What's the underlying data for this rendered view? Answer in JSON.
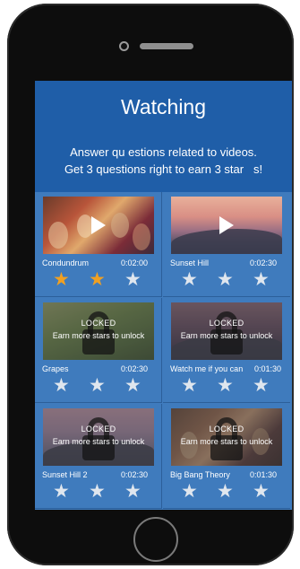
{
  "header": {
    "title": "Watching",
    "subtitle_line1": "Answer qu estions related to videos.",
    "subtitle_line2": "Get 3 questions right to earn 3 star   s!"
  },
  "lock_labels": {
    "title": "LOCKED",
    "subtitle": "Earn more stars to unlock"
  },
  "videos": [
    {
      "name": "Condundrum",
      "duration": "0:02:00",
      "locked": false,
      "stars_earned": 2,
      "stars_total": 3,
      "thumbnail": "sitcom-scene"
    },
    {
      "name": "Sunset Hill",
      "duration": "0:02:30",
      "locked": false,
      "stars_earned": 0,
      "stars_total": 3,
      "thumbnail": "sunset-landscape"
    },
    {
      "name": "Grapes",
      "duration": "0:02:30",
      "locked": true,
      "stars_earned": 0,
      "stars_total": 3,
      "thumbnail": "grape-vines"
    },
    {
      "name": "Watch me if you can",
      "duration": "0:01:30",
      "locked": true,
      "stars_earned": 0,
      "stars_total": 3,
      "thumbnail": "dusk-landscape"
    },
    {
      "name": "Sunset Hill 2",
      "duration": "0:02:30",
      "locked": true,
      "stars_earned": 0,
      "stars_total": 3,
      "thumbnail": "sunset-landscape"
    },
    {
      "name": "Big Bang Theory",
      "duration": "0:01:30",
      "locked": true,
      "stars_earned": 0,
      "stars_total": 3,
      "thumbnail": "sitcom-scene"
    }
  ],
  "icons": {
    "play": "play-icon",
    "lock": "lock-icon",
    "star": "star-icon"
  },
  "colors": {
    "header_bg": "#1f5ea8",
    "grid_bg": "#3f7bbd",
    "star_earned": "#f0a022",
    "star_empty": "#dfe6ee"
  }
}
